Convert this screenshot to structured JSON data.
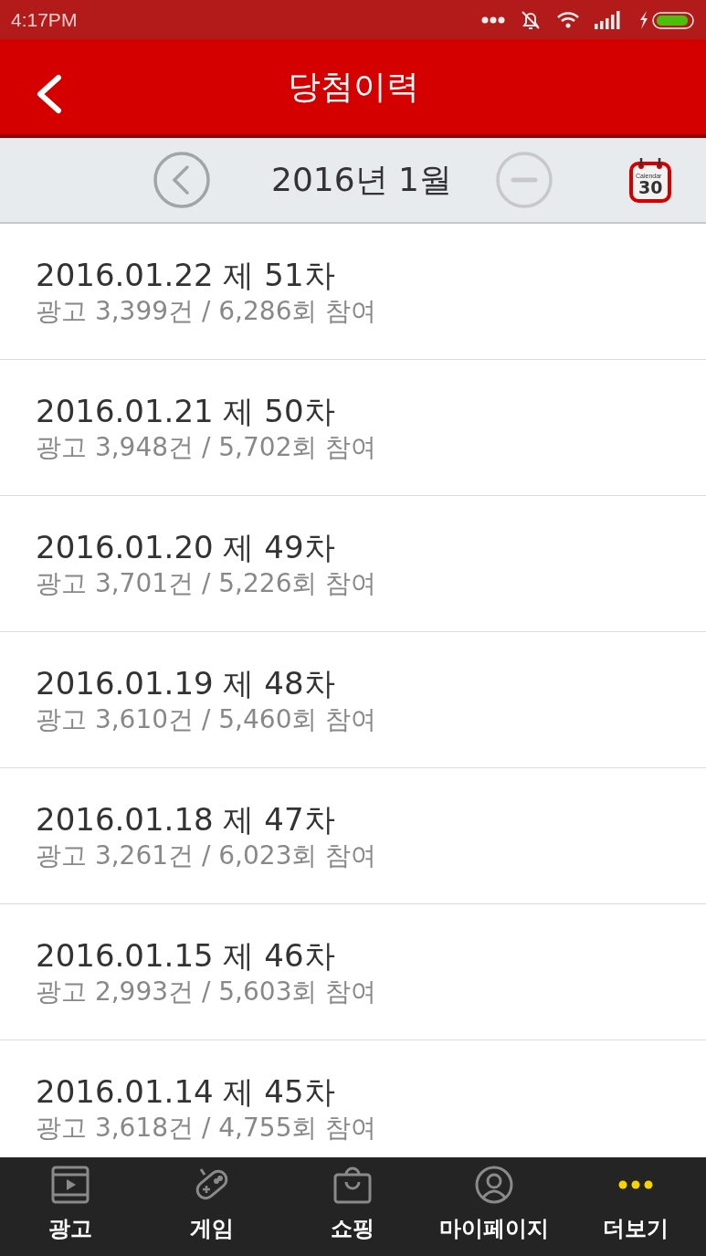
{
  "status_bar": {
    "time": "4:17PM"
  },
  "header": {
    "title": "당첨이력"
  },
  "month_bar": {
    "label": "2016년 1월",
    "next_disabled": true,
    "calendar": {
      "caption": "Calendar",
      "day": "30"
    }
  },
  "rows": [
    {
      "title": "2016.01.22 제 51차",
      "detail": "광고 3,399건 / 6,286회 참여"
    },
    {
      "title": "2016.01.21 제 50차",
      "detail": "광고 3,948건 / 5,702회 참여"
    },
    {
      "title": "2016.01.20 제 49차",
      "detail": "광고 3,701건 / 5,226회 참여"
    },
    {
      "title": "2016.01.19 제 48차",
      "detail": "광고 3,610건 / 5,460회 참여"
    },
    {
      "title": "2016.01.18 제 47차",
      "detail": "광고 3,261건 / 6,023회 참여"
    },
    {
      "title": "2016.01.15 제 46차",
      "detail": "광고 2,993건 / 5,603회 참여"
    },
    {
      "title": "2016.01.14 제 45차",
      "detail": "광고 3,618건 / 4,755회 참여"
    }
  ],
  "tab_bar": [
    {
      "kind": "ad",
      "label": "광고",
      "selected": false
    },
    {
      "kind": "game",
      "label": "게임",
      "selected": false
    },
    {
      "kind": "shop",
      "label": "쇼핑",
      "selected": false
    },
    {
      "kind": "mypage",
      "label": "마이페이지",
      "selected": false
    },
    {
      "kind": "more",
      "label": "더보기",
      "selected": true
    }
  ]
}
